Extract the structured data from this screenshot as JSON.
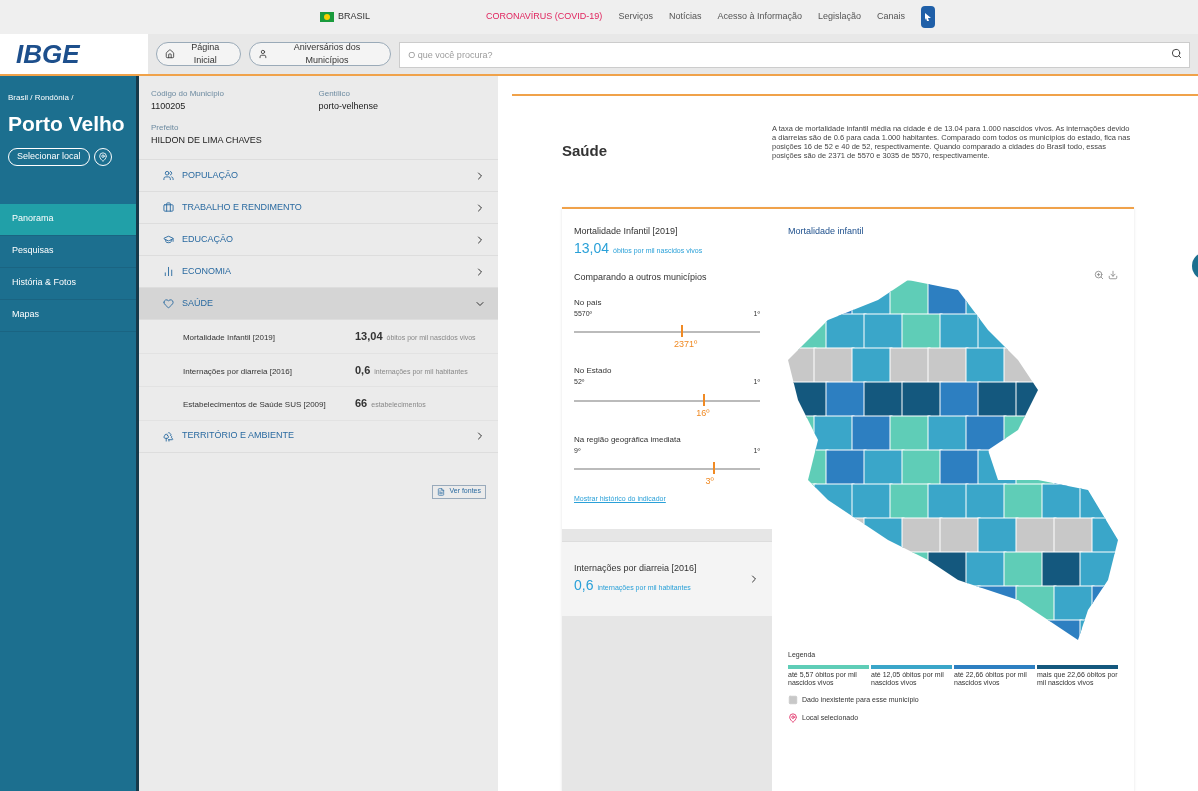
{
  "top_bar": {
    "country": "BRASIL",
    "links": [
      {
        "label": "CORONAVÍRUS (COVID-19)",
        "kind": "alert"
      },
      {
        "label": "Serviços",
        "kind": "normal"
      },
      {
        "label": "Notícias",
        "kind": "normal"
      },
      {
        "label": "Acesso à Informação",
        "kind": "normal"
      },
      {
        "label": "Legislação",
        "kind": "normal"
      },
      {
        "label": "Canais",
        "kind": "normal"
      }
    ]
  },
  "header": {
    "logo": "IBGE",
    "buttons": [
      "Página Inicial",
      "Aniversários dos Municípios"
    ],
    "search": {
      "placeholder": "O que você procura?"
    }
  },
  "sidebar": {
    "breadcrumb": "Brasil / Rondônia /",
    "city": "Porto Velho",
    "select_button": "Selecionar local",
    "items": [
      {
        "label": "Panorama",
        "selected": true
      },
      {
        "label": "Pesquisas",
        "selected": false
      },
      {
        "label": "História & Fotos",
        "selected": false
      },
      {
        "label": "Mapas",
        "selected": false
      }
    ]
  },
  "info": [
    {
      "label": "Código do Município",
      "value": "1100205"
    },
    {
      "label": "Gentílico",
      "value": "porto-velhense"
    },
    {
      "label": "Prefeito",
      "value": "HILDON DE LIMA CHAVES"
    }
  ],
  "categories": [
    {
      "label": "POPULAÇÃO",
      "expanded": false
    },
    {
      "label": "TRABALHO E RENDIMENTO",
      "expanded": false
    },
    {
      "label": "EDUCAÇÃO",
      "expanded": false
    },
    {
      "label": "ECONOMIA",
      "expanded": false
    },
    {
      "label": "SAÚDE",
      "expanded": true,
      "rows": [
        {
          "name": "Mortalidade Infantil [2019]",
          "value": "13,04",
          "unit": "óbitos por mil nascidos vivos"
        },
        {
          "name": "Internações por diarreia [2016]",
          "value": "0,6",
          "unit": "internações por mil habitantes"
        },
        {
          "name": "Estabelecimentos de Saúde SUS [2009]",
          "value": "66",
          "unit": "estabelecimentos"
        }
      ]
    },
    {
      "label": "TERRITÓRIO E AMBIENTE",
      "expanded": false
    }
  ],
  "sources_button": "Ver fontes",
  "section": {
    "title": "Saúde",
    "summary": "A taxa de mortalidade infantil média na cidade é de 13.04 para 1.000 nascidos vivos. As internações devido a diarreias são de 0.6 para cada 1.000 habitantes. Comparado com todos os municípios do estado, fica nas posições 16 de 52 e 40 de 52, respectivamente. Quando comparado a cidades do Brasil todo, essas posições são de 2371 de 5570 e 3035 de 5570, respectivamente."
  },
  "indicator": {
    "title": "Mortalidade Infantil [2019]",
    "value": "13,04",
    "unit": "óbitos por mil nascidos vivos",
    "compare_label": "Comparando a outros municípios",
    "rankings": [
      {
        "label": "No país",
        "min": "5570º",
        "max": "1º",
        "position": "2371º",
        "level": 0.58
      },
      {
        "label": "No Estado",
        "min": "52º",
        "max": "1º",
        "position": "16º",
        "level": 0.7
      },
      {
        "label": "Na região geográfica imediata",
        "min": "9º",
        "max": "1º",
        "position": "3º",
        "level": 0.75
      }
    ],
    "history_link": "Mostrar histórico do indicador"
  },
  "next_indicator": {
    "title": "Internações por diarreia [2016]",
    "value": "0,6",
    "unit": "internações por mil habitantes"
  },
  "map": {
    "title": "Mortalidade infantil",
    "legend_title": "Legenda",
    "legend": [
      {
        "label": "até 5,57 óbitos por mil nascidos vivos",
        "color": "#5fcdb7"
      },
      {
        "label": "até 12,05 óbitos por mil nascidos vivos",
        "color": "#3aa6c9"
      },
      {
        "label": "até 22,66 óbitos por mil nascidos vivos",
        "color": "#2d7fc1"
      },
      {
        "label": "mais que 22,66 óbitos por mil nascidos vivos",
        "color": "#14587e"
      }
    ],
    "no_data": "Dado inexistente para esse município",
    "selected_place": "Local selecionado"
  }
}
